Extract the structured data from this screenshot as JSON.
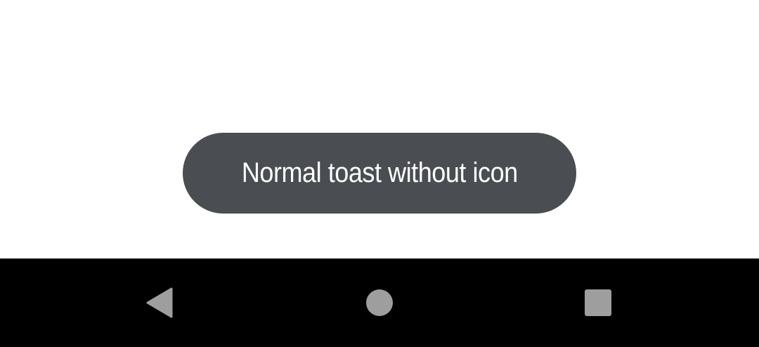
{
  "toast": {
    "message": "Normal toast without icon",
    "background": "#4a4d51",
    "text_color": "#ffffff"
  },
  "navigation_bar": {
    "background": "#000000",
    "icon_color": "#9e9e9e",
    "buttons": [
      {
        "icon": "back-triangle-icon"
      },
      {
        "icon": "home-circle-icon"
      },
      {
        "icon": "recents-square-icon"
      }
    ]
  }
}
